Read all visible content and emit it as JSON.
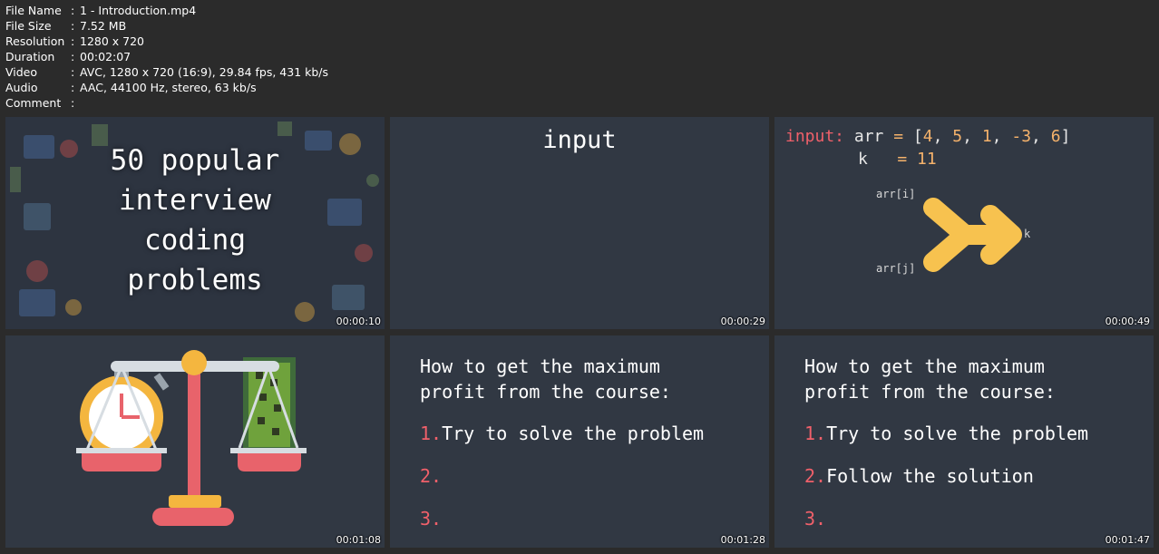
{
  "meta": [
    {
      "key": "File Name",
      "value": "1 - Introduction.mp4"
    },
    {
      "key": "File Size",
      "value": "7.52 MB"
    },
    {
      "key": "Resolution",
      "value": "1280 x 720"
    },
    {
      "key": "Duration",
      "value": "00:02:07"
    },
    {
      "key": "Video",
      "value": "AVC, 1280 x 720 (16:9), 29.84 fps, 431 kb/s"
    },
    {
      "key": "Audio",
      "value": "AAC, 44100 Hz, stereo, 63 kb/s"
    },
    {
      "key": "Comment",
      "value": ""
    }
  ],
  "separator": ":",
  "frames": [
    {
      "timestamp": "00:00:10",
      "title_lines": [
        "50 popular",
        "interview",
        "coding",
        "problems"
      ]
    },
    {
      "timestamp": "00:00:29",
      "word": "input"
    },
    {
      "timestamp": "00:00:49",
      "label": "input:",
      "arr_text": "arr",
      "eq": "=",
      "bracket_open": "[",
      "bracket_close": "]",
      "arr_values": [
        "4",
        "5",
        "1",
        "-3",
        "6"
      ],
      "k_text": "k",
      "k_value": "11",
      "arr_i": "arr[i]",
      "arr_j": "arr[j]",
      "k_label": "k"
    },
    {
      "timestamp": "00:01:08"
    },
    {
      "timestamp": "00:01:28",
      "heading_lines": [
        "How to get the maximum",
        "profit from the course:"
      ],
      "items": [
        {
          "num": "1.",
          "text": "Try to solve the problem"
        },
        {
          "num": "2.",
          "text": ""
        },
        {
          "num": "3.",
          "text": ""
        }
      ]
    },
    {
      "timestamp": "00:01:47",
      "heading_lines": [
        "How to get the maximum",
        "profit from the course:"
      ],
      "items": [
        {
          "num": "1.",
          "text": "Try to solve the problem"
        },
        {
          "num": "2.",
          "text": "Follow the solution"
        },
        {
          "num": "3.",
          "text": ""
        }
      ]
    }
  ],
  "colors": {
    "background": "#2b2b2b",
    "slide": "#313843",
    "accent_red": "#f0606a",
    "accent_orange": "#f5b26b",
    "arrow_yellow": "#f7c24f"
  }
}
